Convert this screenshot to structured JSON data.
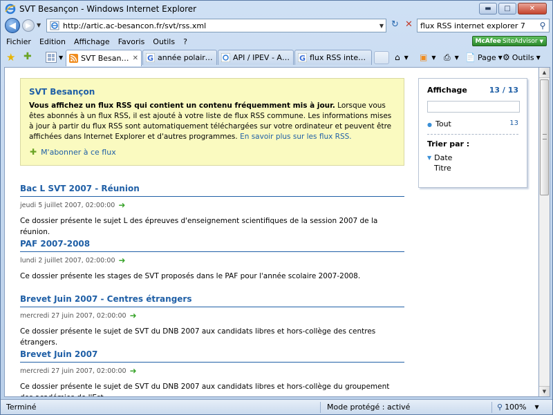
{
  "window": {
    "title": "SVT Besançon - Windows Internet Explorer"
  },
  "addressbar": {
    "url": "http://artic.ac-besancon.fr/svt/rss.xml"
  },
  "search": {
    "value": "flux RSS internet explorer 7"
  },
  "menu": {
    "items": [
      "Fichier",
      "Edition",
      "Affichage",
      "Favoris",
      "Outils",
      "?"
    ]
  },
  "mcafee": {
    "brand": "McAfee",
    "label": "SiteAdvisor"
  },
  "tabs": [
    {
      "label": "SVT Besançon",
      "active": true
    },
    {
      "label": "année polaire inter..."
    },
    {
      "label": "API / IPEV - Année ..."
    },
    {
      "label": "flux RSS internet ex..."
    }
  ],
  "commands": {
    "page": "Page",
    "tools": "Outils"
  },
  "feed": {
    "title": "SVT Besançon",
    "intro_bold": "Vous affichez un flux RSS qui contient un contenu fréquemment mis à jour.",
    "intro_text": " Lorsque vous êtes abonnés à un flux RSS, il est ajouté à votre liste de flux RSS commune. Les informations mises à jour à partir du flux RSS sont automatiquement téléchargées sur votre ordinateur et peuvent être affichées dans Internet Explorer et d'autres programmes. ",
    "learn_more": "En savoir plus sur les flux RSS.",
    "subscribe": "M'abonner à ce flux"
  },
  "items": [
    {
      "title": "Bac L SVT 2007 - Réunion",
      "date": "jeudi 5 juillet 2007, 02:00:00",
      "desc": "Ce dossier présente le sujet L des épreuves d'enseignement scientifiques de la session 2007 de la réunion."
    },
    {
      "title": "PAF 2007-2008",
      "date": "lundi 2 juillet 2007, 02:00:00",
      "desc": "Ce dossier présente les stages de SVT proposés dans le PAF pour l'année scolaire 2007-2008."
    },
    {
      "title": "Brevet Juin 2007 - Centres étrangers",
      "date": "mercredi 27 juin 2007, 02:00:00",
      "desc": "Ce dossier présente le sujet de SVT du DNB 2007 aux candidats libres et hors-collège des centres étrangers."
    },
    {
      "title": "Brevet Juin 2007",
      "date": "mercredi 27 juin 2007, 02:00:00",
      "desc": "Ce dossier présente le sujet de SVT du DNB 2007 aux candidats libres et hors-collège du groupement des académies de l'Est."
    }
  ],
  "panel": {
    "heading": "Affichage",
    "count": "13 / 13",
    "all_label": "Tout",
    "all_count": "13",
    "sort_heading": "Trier par :",
    "sort_date": "Date",
    "sort_title": "Titre"
  },
  "status": {
    "text": "Terminé",
    "mode": "Mode protégé : activé",
    "zoom": "100%"
  }
}
